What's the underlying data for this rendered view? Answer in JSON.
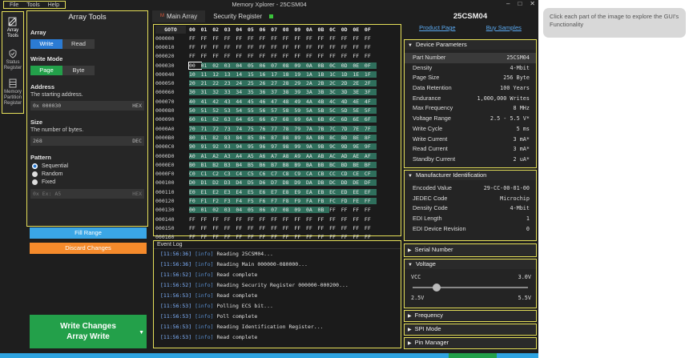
{
  "window": {
    "title": "Memory Xplorer - 25CSM04",
    "menu": [
      "File",
      "Tools",
      "Help"
    ],
    "controls": [
      "–",
      "□",
      "✕"
    ]
  },
  "sidebar": {
    "items": [
      {
        "label": "Array Tools",
        "icon": "pencil-icon"
      },
      {
        "label": "Status Register",
        "icon": "shield-icon"
      },
      {
        "label": "Memory Partition Register",
        "icon": "partition-icon"
      }
    ]
  },
  "array_tools": {
    "title": "Array Tools",
    "array": {
      "label": "Array",
      "options": [
        "Write",
        "Read"
      ],
      "selected": "Write"
    },
    "write_mode": {
      "label": "Write Mode",
      "options": [
        "Page",
        "Byte"
      ],
      "selected": "Page"
    },
    "address": {
      "label": "Address",
      "desc": "The starting address.",
      "value": "0x 000030",
      "unit": "HEX"
    },
    "size": {
      "label": "Size",
      "desc": "The number of bytes.",
      "value": "268",
      "unit": "DEC"
    },
    "pattern": {
      "label": "Pattern",
      "options": [
        "Sequential",
        "Random",
        "Fixed"
      ],
      "selected": "Sequential",
      "fixed_placeholder": "0x Ex: A5",
      "fixed_unit": "HEX"
    },
    "fill_label": "Fill Range",
    "discard_label": "Discard Changes",
    "write_label_1": "Write Changes",
    "write_label_2": "Array Write"
  },
  "tabs": [
    {
      "label": "Main Array",
      "active": true
    },
    {
      "label": "Security Register",
      "active": false
    }
  ],
  "hex": {
    "goto": "GOTO",
    "columns": [
      "00",
      "01",
      "02",
      "03",
      "04",
      "05",
      "06",
      "07",
      "08",
      "09",
      "0A",
      "0B",
      "0C",
      "0D",
      "0E",
      "0F"
    ],
    "rows": [
      {
        "addr": "000000",
        "bytes": [
          "FF",
          "FF",
          "FF",
          "FF",
          "FF",
          "FF",
          "FF",
          "FF",
          "FF",
          "FF",
          "FF",
          "FF",
          "FF",
          "FF",
          "FF",
          "FF"
        ]
      },
      {
        "addr": "000010",
        "bytes": [
          "FF",
          "FF",
          "FF",
          "FF",
          "FF",
          "FF",
          "FF",
          "FF",
          "FF",
          "FF",
          "FF",
          "FF",
          "FF",
          "FF",
          "FF",
          "FF"
        ]
      },
      {
        "addr": "000020",
        "bytes": [
          "FF",
          "FF",
          "FF",
          "FF",
          "FF",
          "FF",
          "FF",
          "FF",
          "FF",
          "FF",
          "FF",
          "FF",
          "FF",
          "FF",
          "FF",
          "FF"
        ]
      },
      {
        "addr": "000030",
        "bytes": [
          "00",
          "01",
          "02",
          "03",
          "04",
          "05",
          "06",
          "07",
          "08",
          "09",
          "0A",
          "0B",
          "0C",
          "0D",
          "0E",
          "0F"
        ]
      },
      {
        "addr": "000040",
        "bytes": [
          "10",
          "11",
          "12",
          "13",
          "14",
          "15",
          "16",
          "17",
          "18",
          "19",
          "1A",
          "1B",
          "1C",
          "1D",
          "1E",
          "1F"
        ]
      },
      {
        "addr": "000050",
        "bytes": [
          "20",
          "21",
          "22",
          "23",
          "24",
          "25",
          "26",
          "27",
          "28",
          "29",
          "2A",
          "2B",
          "2C",
          "2D",
          "2E",
          "2F"
        ]
      },
      {
        "addr": "000060",
        "bytes": [
          "30",
          "31",
          "32",
          "33",
          "34",
          "35",
          "36",
          "37",
          "38",
          "39",
          "3A",
          "3B",
          "3C",
          "3D",
          "3E",
          "3F"
        ]
      },
      {
        "addr": "000070",
        "bytes": [
          "40",
          "41",
          "42",
          "43",
          "44",
          "45",
          "46",
          "47",
          "48",
          "49",
          "4A",
          "4B",
          "4C",
          "4D",
          "4E",
          "4F"
        ]
      },
      {
        "addr": "000080",
        "bytes": [
          "50",
          "51",
          "52",
          "53",
          "54",
          "55",
          "56",
          "57",
          "58",
          "59",
          "5A",
          "5B",
          "5C",
          "5D",
          "5E",
          "5F"
        ]
      },
      {
        "addr": "000090",
        "bytes": [
          "60",
          "61",
          "62",
          "63",
          "64",
          "65",
          "66",
          "67",
          "68",
          "69",
          "6A",
          "6B",
          "6C",
          "6D",
          "6E",
          "6F"
        ]
      },
      {
        "addr": "0000A0",
        "bytes": [
          "70",
          "71",
          "72",
          "73",
          "74",
          "75",
          "76",
          "77",
          "78",
          "79",
          "7A",
          "7B",
          "7C",
          "7D",
          "7E",
          "7F"
        ]
      },
      {
        "addr": "0000B0",
        "bytes": [
          "80",
          "81",
          "82",
          "83",
          "84",
          "85",
          "86",
          "87",
          "88",
          "89",
          "8A",
          "8B",
          "8C",
          "8D",
          "8E",
          "8F"
        ]
      },
      {
        "addr": "0000C0",
        "bytes": [
          "90",
          "91",
          "92",
          "93",
          "94",
          "95",
          "96",
          "97",
          "98",
          "99",
          "9A",
          "9B",
          "9C",
          "9D",
          "9E",
          "9F"
        ]
      },
      {
        "addr": "0000D0",
        "bytes": [
          "A0",
          "A1",
          "A2",
          "A3",
          "A4",
          "A5",
          "A6",
          "A7",
          "A8",
          "A9",
          "AA",
          "AB",
          "AC",
          "AD",
          "AE",
          "AF"
        ]
      },
      {
        "addr": "0000E0",
        "bytes": [
          "B0",
          "B1",
          "B2",
          "B3",
          "B4",
          "B5",
          "B6",
          "B7",
          "B8",
          "B9",
          "BA",
          "BB",
          "BC",
          "BD",
          "BE",
          "BF"
        ]
      },
      {
        "addr": "0000F0",
        "bytes": [
          "C0",
          "C1",
          "C2",
          "C3",
          "C4",
          "C5",
          "C6",
          "C7",
          "C8",
          "C9",
          "CA",
          "CB",
          "CC",
          "CD",
          "CE",
          "CF"
        ]
      },
      {
        "addr": "000100",
        "bytes": [
          "D0",
          "D1",
          "D2",
          "D3",
          "D4",
          "D5",
          "D6",
          "D7",
          "D8",
          "D9",
          "DA",
          "DB",
          "DC",
          "DD",
          "DE",
          "DF"
        ]
      },
      {
        "addr": "000110",
        "bytes": [
          "E0",
          "E1",
          "E2",
          "E3",
          "E4",
          "E5",
          "E6",
          "E7",
          "E8",
          "E9",
          "EA",
          "EB",
          "EC",
          "ED",
          "EE",
          "EF"
        ]
      },
      {
        "addr": "000120",
        "bytes": [
          "F0",
          "F1",
          "F2",
          "F3",
          "F4",
          "F5",
          "F6",
          "F7",
          "F8",
          "F9",
          "FA",
          "FB",
          "FC",
          "FD",
          "FE",
          "FF"
        ]
      },
      {
        "addr": "000130",
        "bytes": [
          "00",
          "01",
          "02",
          "03",
          "04",
          "05",
          "06",
          "07",
          "08",
          "09",
          "0A",
          "0B",
          "FF",
          "FF",
          "FF",
          "FF"
        ]
      },
      {
        "addr": "000140",
        "bytes": [
          "FF",
          "FF",
          "FF",
          "FF",
          "FF",
          "FF",
          "FF",
          "FF",
          "FF",
          "FF",
          "FF",
          "FF",
          "FF",
          "FF",
          "FF",
          "FF"
        ]
      },
      {
        "addr": "000150",
        "bytes": [
          "FF",
          "FF",
          "FF",
          "FF",
          "FF",
          "FF",
          "FF",
          "FF",
          "FF",
          "FF",
          "FF",
          "FF",
          "FF",
          "FF",
          "FF",
          "FF"
        ]
      },
      {
        "addr": "000160",
        "bytes": [
          "FF",
          "FF",
          "FF",
          "FF",
          "FF",
          "FF",
          "FF",
          "FF",
          "FF",
          "FF",
          "FF",
          "FF",
          "FF",
          "FF",
          "FF",
          "FF"
        ]
      }
    ]
  },
  "event_log": {
    "title": "Event Log",
    "entries": [
      {
        "time": "[11:56:36]",
        "level": "[info]",
        "msg": "Reading 25CSM04..."
      },
      {
        "time": "[11:56:36]",
        "level": "[info]",
        "msg": "Reading Main 000000-080000..."
      },
      {
        "time": "[11:56:52]",
        "level": "[info]",
        "msg": "Read complete"
      },
      {
        "time": "[11:56:52]",
        "level": "[info]",
        "msg": "Reading Security Register 000000-000200..."
      },
      {
        "time": "[11:56:53]",
        "level": "[info]",
        "msg": "Read complete"
      },
      {
        "time": "[11:56:53]",
        "level": "[info]",
        "msg": "Polling ECS bit..."
      },
      {
        "time": "[11:56:53]",
        "level": "[info]",
        "msg": "Poll complete"
      },
      {
        "time": "[11:56:53]",
        "level": "[info]",
        "msg": "Reading Identification Register..."
      },
      {
        "time": "[11:56:53]",
        "level": "[info]",
        "msg": "Read complete"
      }
    ]
  },
  "device": {
    "title": "25CSM04",
    "links": [
      "Product Page",
      "Buy Samples"
    ],
    "params_title": "Device Parameters",
    "params": [
      {
        "k": "Part Number",
        "v": "25CSM04"
      },
      {
        "k": "Density",
        "v": "4-Mbit"
      },
      {
        "k": "Page Size",
        "v": "256 Byte"
      },
      {
        "k": "Data Retention",
        "v": "100 Years"
      },
      {
        "k": "Endurance",
        "v": "1,000,000 Writes"
      },
      {
        "k": "Max Frequency",
        "v": "8 MHz"
      },
      {
        "k": "Voltage Range",
        "v": "2.5 - 5.5 V*"
      },
      {
        "k": "Write Cycle",
        "v": "5 ms"
      },
      {
        "k": "Write Current",
        "v": "3 mA*"
      },
      {
        "k": "Read Current",
        "v": "3 mA*"
      },
      {
        "k": "Standby Current",
        "v": "2 uA*"
      }
    ],
    "mfr_title": "Manufacturer Identification",
    "mfr": [
      {
        "k": "Encoded Value",
        "v": "29-CC-00-01-00"
      },
      {
        "k": "JEDEC Code",
        "v": "Microchip"
      },
      {
        "k": "Density Code",
        "v": "4-Mbit"
      },
      {
        "k": "EDI Length",
        "v": "1"
      },
      {
        "k": "EDI Device Revision",
        "v": "0"
      }
    ],
    "serial_title": "Serial Number",
    "voltage_title": "Voltage",
    "vcc_label": "VCC",
    "vcc_value": "3.0V",
    "vmin": "2.5V",
    "vmax": "5.5V",
    "frequency_title": "Frequency",
    "spi_title": "SPI Mode",
    "pin_title": "Pin Manager"
  },
  "tooltip": "Click each part of the image to explore the GUI's Functionality"
}
